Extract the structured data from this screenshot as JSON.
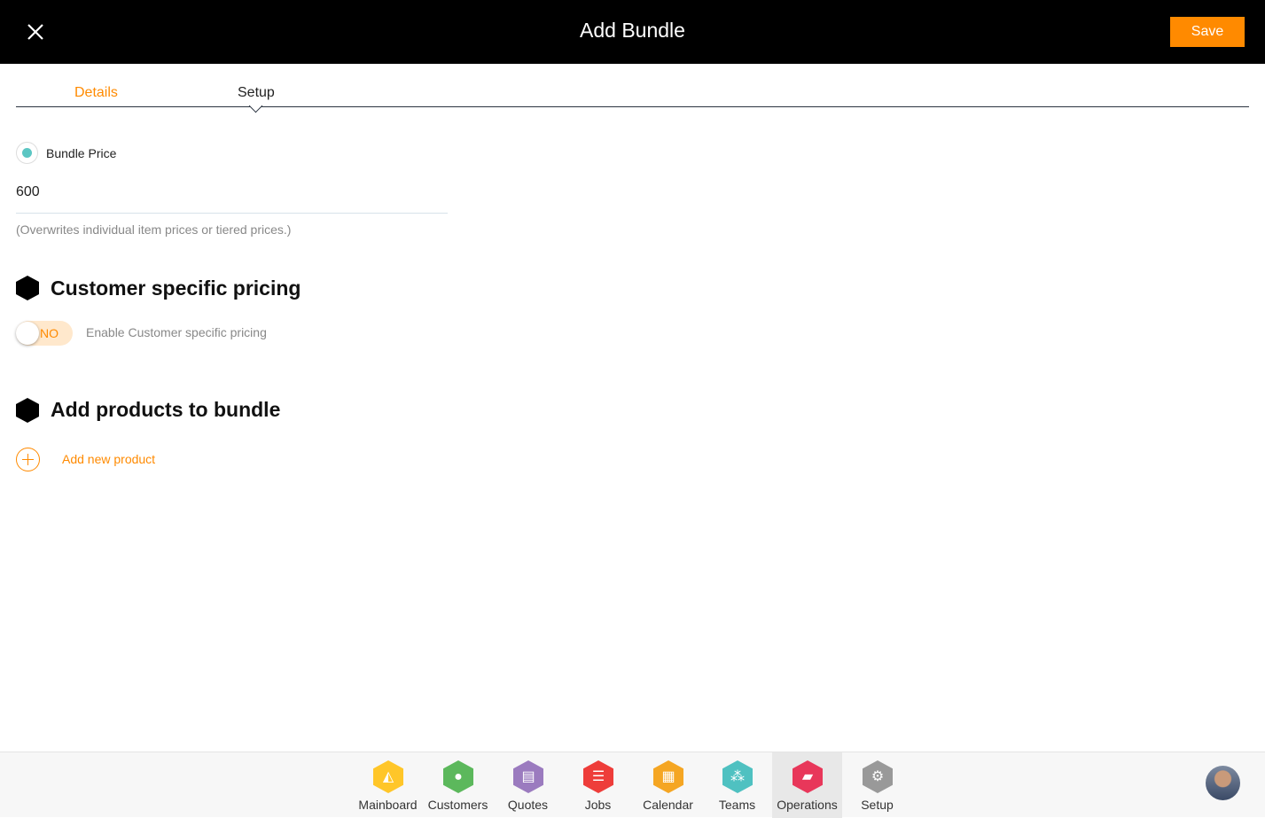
{
  "header": {
    "title": "Add Bundle",
    "save_label": "Save"
  },
  "tabs": [
    {
      "label": "Details",
      "active": false
    },
    {
      "label": "Setup",
      "active": true
    }
  ],
  "pricing": {
    "radio_label": "Bundle Price",
    "price_value": "600",
    "hint": "(Overwrites individual item prices or tiered prices.)"
  },
  "customer_pricing": {
    "title": "Customer specific pricing",
    "toggle_state": "NO",
    "toggle_label": "Enable Customer specific pricing"
  },
  "products": {
    "title": "Add products to bundle",
    "add_label": "Add new product"
  },
  "colors": {
    "accent": "#ff8a00",
    "radio": "#5bc6c3"
  },
  "nav": [
    {
      "label": "Mainboard",
      "icon": "mainboard-icon",
      "color": "#ffc629"
    },
    {
      "label": "Customers",
      "icon": "person-icon",
      "color": "#5cb85c"
    },
    {
      "label": "Quotes",
      "icon": "quotes-icon",
      "color": "#9b7bbf"
    },
    {
      "label": "Jobs",
      "icon": "list-icon",
      "color": "#ee3d3a"
    },
    {
      "label": "Calendar",
      "icon": "calendar-icon",
      "color": "#f5a623"
    },
    {
      "label": "Teams",
      "icon": "teams-icon",
      "color": "#4fc1c1"
    },
    {
      "label": "Operations",
      "icon": "briefcase-icon",
      "color": "#e8375a",
      "active": true
    },
    {
      "label": "Setup",
      "icon": "gear-icon",
      "color": "#999999"
    }
  ]
}
